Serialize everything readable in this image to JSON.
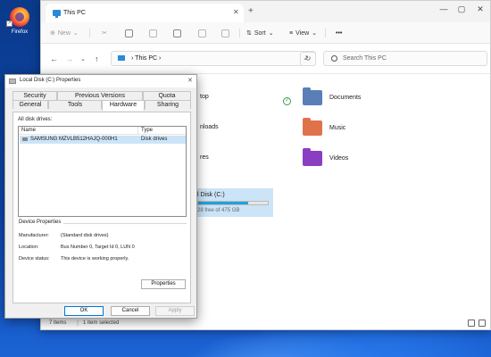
{
  "desktop": {
    "icon_label": "Firefox"
  },
  "explorer": {
    "tab_title": "This PC",
    "toolbar": {
      "new": "New",
      "sort": "Sort",
      "view": "View",
      "more": "•••"
    },
    "address_path": "This PC",
    "search_placeholder": "Search This PC",
    "folders": [
      {
        "name": "Documents",
        "color": "#5a7fb8"
      },
      {
        "name": "Music",
        "color": "#e0724a"
      },
      {
        "name": "Videos",
        "color": "#8a3fc2"
      }
    ],
    "partial_labels": {
      "desktop": "top",
      "downloads": "nloads",
      "pictures": "res"
    },
    "drive": {
      "name": "l Disk (C:)",
      "space": "28 free of 475 GB",
      "used_fraction": 0.72,
      "bar_color": "#26a0da"
    },
    "status": {
      "items": "7 items",
      "selected": "1 item selected"
    }
  },
  "dialog": {
    "title": "Local Disk (C:) Properties",
    "tabs_top": [
      "Security",
      "Previous Versions",
      "Quota"
    ],
    "tabs_bottom": [
      "General",
      "Tools",
      "Hardware",
      "Sharing"
    ],
    "all_disk_drives_label": "All disk drives:",
    "columns": [
      "Name",
      "Type"
    ],
    "rows": [
      {
        "name": "SAMSUNG MZVLB512HAJQ-000H1",
        "type": "Disk drives"
      }
    ],
    "device_properties_title": "Device Properties",
    "properties": [
      {
        "label": "Manufacturer:",
        "value": "(Standard disk drives)"
      },
      {
        "label": "Location:",
        "value": "Bus Number 0, Target Id 0, LUN 0"
      },
      {
        "label": "Device status:",
        "value": "This device is working properly."
      }
    ],
    "properties_button": "Properties",
    "ok": "OK",
    "cancel": "Cancel",
    "apply": "Apply"
  }
}
